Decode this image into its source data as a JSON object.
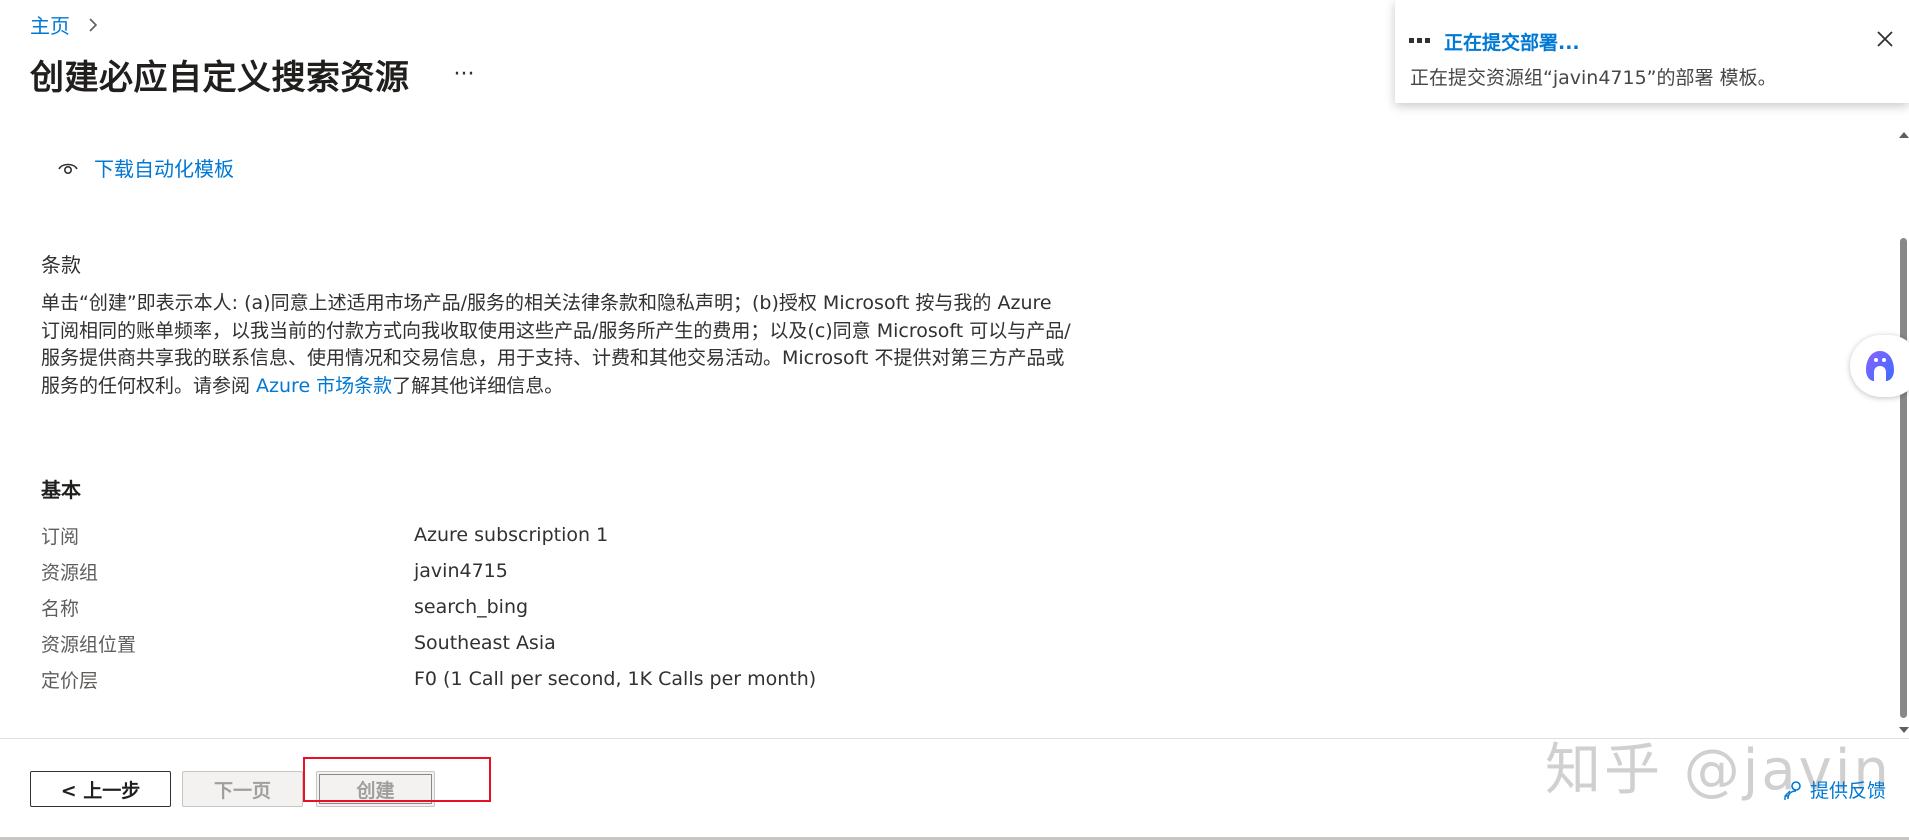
{
  "breadcrumb": {
    "home": "主页"
  },
  "page": {
    "title": "创建必应自定义搜索资源",
    "more_label": "···"
  },
  "download": {
    "label": "下载自动化模板"
  },
  "terms": {
    "heading": "条款",
    "text_before_link": "单击“创建”即表示本人: (a)同意上述适用市场产品/服务的相关法律条款和隐私声明；(b)授权 Microsoft 按与我的 Azure 订阅相同的账单频率，以我当前的付款方式向我收取使用这些产品/服务所产生的费用；以及(c)同意 Microsoft 可以与产品/服务提供商共享我的联系信息、使用情况和交易信息，用于支持、计费和其他交易活动。Microsoft 不提供对第三方产品或服务的任何权利。请参阅 ",
    "link": "Azure 市场条款",
    "text_after_link": "了解其他详细信息。"
  },
  "basics": {
    "heading": "基本",
    "rows": [
      {
        "label": "订阅",
        "value": "Azure subscription 1"
      },
      {
        "label": "资源组",
        "value": "javin4715"
      },
      {
        "label": "名称",
        "value": "search_bing"
      },
      {
        "label": "资源组位置",
        "value": "Southeast Asia"
      },
      {
        "label": "定价层",
        "value": "F0 (1 Call per second, 1K Calls per month)"
      }
    ]
  },
  "footer": {
    "prev_label": "< 上一步",
    "next_label": "下一页",
    "create_label": "创建",
    "feedback_label": "提供反馈",
    "watermark": "知乎 @javin"
  },
  "toast": {
    "title": "正在提交部署...",
    "body": "正在提交资源组“javin4715”的部署 模板。"
  },
  "colors": {
    "accent": "#0078d4",
    "highlight": "#e81123"
  }
}
